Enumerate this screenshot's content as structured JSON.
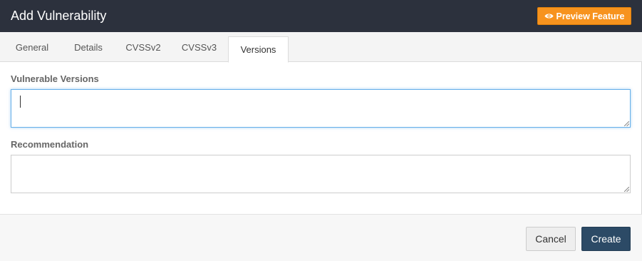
{
  "dialog": {
    "title": "Add Vulnerability",
    "preview_label": "Preview Feature",
    "preview_icon": "eye-icon",
    "colors": {
      "header_bg": "#2c313d",
      "preview_bg": "#f7931e",
      "create_bg": "#2c4a66",
      "focus_border": "#66afe9"
    }
  },
  "tabs": [
    {
      "label": "General",
      "active": false
    },
    {
      "label": "Details",
      "active": false
    },
    {
      "label": "CVSSv2",
      "active": false
    },
    {
      "label": "CVSSv3",
      "active": false
    },
    {
      "label": "Versions",
      "active": true
    }
  ],
  "form": {
    "vulnerable_versions": {
      "label": "Vulnerable Versions",
      "value": "",
      "focused": true
    },
    "recommendation": {
      "label": "Recommendation",
      "value": "",
      "focused": false
    }
  },
  "footer": {
    "cancel_label": "Cancel",
    "create_label": "Create"
  }
}
